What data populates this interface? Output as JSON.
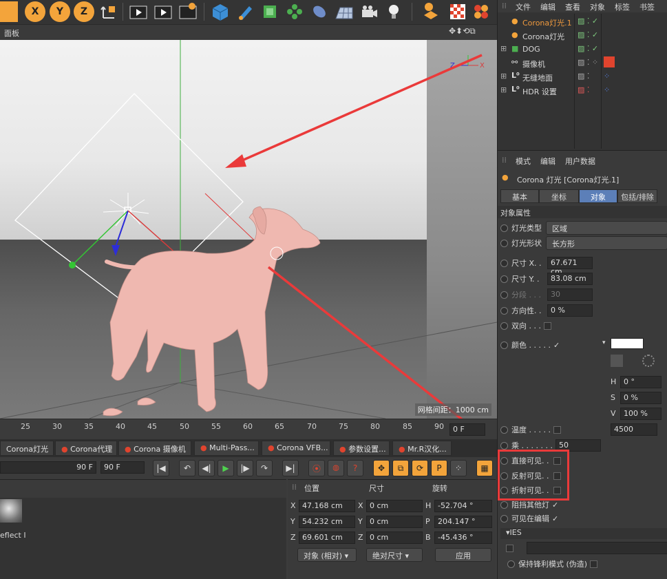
{
  "toolbar": {
    "axis_buttons": [
      "X",
      "Y",
      "Z"
    ]
  },
  "viewport": {
    "panel_label": "面板",
    "grid_label": "网格间距：1000 cm"
  },
  "timeline": {
    "ticks": [
      "25",
      "30",
      "35",
      "40",
      "45",
      "50",
      "55",
      "60",
      "65",
      "70",
      "75",
      "80",
      "85",
      "90"
    ],
    "frame_field": "0 F"
  },
  "render_tabs": [
    "Corona灯光",
    "Corona代理",
    "Corona 摄像机",
    "Multi-Pass...",
    "Corona VFB...",
    "参数设置...",
    "Mr.R汉化..."
  ],
  "playbar": {
    "end_field_a": "90 F",
    "end_field_b": "90 F"
  },
  "material": {
    "label": "eflect I"
  },
  "coords": {
    "headers": {
      "position": "位置",
      "size": "尺寸",
      "rotation": "旋转"
    },
    "rows": [
      {
        "axis": "X",
        "pos": "47.168 cm",
        "saxis": "X",
        "size": "0 cm",
        "raxis": "H",
        "rot": "-52.704 °"
      },
      {
        "axis": "Y",
        "pos": "54.232 cm",
        "saxis": "Y",
        "size": "0 cm",
        "raxis": "P",
        "rot": "204.147 °"
      },
      {
        "axis": "Z",
        "pos": "69.601 cm",
        "saxis": "Z",
        "size": "0 cm",
        "raxis": "B",
        "rot": "-45.436 °"
      }
    ],
    "mode_dropdown": "对象 (相对)",
    "size_dropdown": "绝对尺寸",
    "apply_button": "应用"
  },
  "object_manager": {
    "menu": [
      "文件",
      "编辑",
      "查看",
      "对象",
      "标签",
      "书签"
    ],
    "objects": [
      {
        "name": "Corona灯光.1",
        "selected": true,
        "color": "#f09a3e"
      },
      {
        "name": "Corona灯光",
        "selected": false,
        "color": "#d0d0d0"
      },
      {
        "name": "DOG",
        "selected": false,
        "color": "#d0d0d0"
      },
      {
        "name": "摄像机",
        "selected": false,
        "color": "#d0d0d0"
      },
      {
        "name": "无缝地面",
        "selected": false,
        "color": "#d0d0d0"
      },
      {
        "name": "HDR 设置",
        "selected": false,
        "color": "#d0d0d0"
      }
    ]
  },
  "attributes": {
    "menu": [
      "模式",
      "编辑",
      "用户数据"
    ],
    "title": "Corona 灯光 [Corona灯光.1]",
    "tabs": [
      "基本",
      "坐标",
      "对象",
      "包括/排除"
    ],
    "active_tab": "对象",
    "section": "对象属性",
    "light_type_label": "灯光类型",
    "light_type_value": "区域",
    "light_shape_label": "灯光形状",
    "light_shape_value": "长方形",
    "size_x_label": "尺寸 X. .",
    "size_x_value": "67.671 cm",
    "size_y_label": "尺寸 Y. .",
    "size_y_value": "83.08 cm",
    "segments_label": "分段 . . .",
    "segments_value": "30",
    "directionality_label": "方向性. .",
    "directionality_value": "0 %",
    "twosided_label": "双向 . . .",
    "color_label": "颜色 . . . . .",
    "color_value": "#ffffff",
    "h_label": "H",
    "h_value": "0 °",
    "s_label": "S",
    "s_value": "0 %",
    "v_label": "V",
    "v_value": "100 %",
    "temp_label": "温度 . . . . .",
    "temp_value": "4500",
    "multiplier_label": "乘 . . . . . . .",
    "multiplier_value": "50",
    "visible_direct": "直接可见. .",
    "visible_reflect": "反射可见. .",
    "visible_refract": "折射可见. .",
    "occlude": "阻挡其他灯",
    "visible_editor": "可见在编辑",
    "ies_label": "▾IES",
    "keep_sharp": "保持锋利模式 (伪造)"
  }
}
